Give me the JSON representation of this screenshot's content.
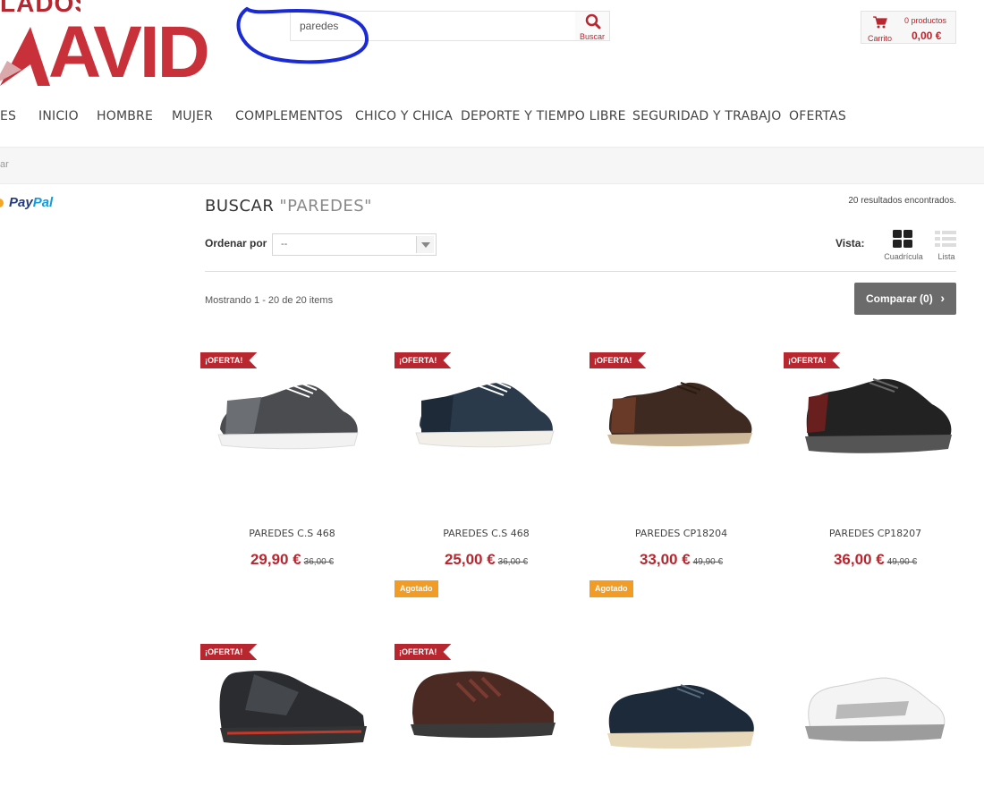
{
  "header": {
    "logo_top": "LADOS",
    "logo_main": "AVID",
    "search": {
      "value": "paredes",
      "button_label": "Buscar"
    },
    "cart": {
      "label": "Carrito",
      "count": "0 productos",
      "total": "0,00 €"
    }
  },
  "menu": [
    "ES",
    "INICIO",
    "HOMBRE",
    "MUJER",
    "COMPLEMENTOS",
    "CHICO Y CHICA",
    "DEPORTE Y TIEMPO LIBRE",
    "SEGURIDAD Y TRABAJO",
    "OFERTAS"
  ],
  "breadcrumb": "ar",
  "sidebar": {
    "paypal_a": "Pay",
    "paypal_b": "Pal"
  },
  "main": {
    "heading": "BUSCAR",
    "query": "\"PAREDES\"",
    "results": "20 resultados encontrados.",
    "sort_label": "Ordenar por",
    "sort_value": "--",
    "vista_label": "Vista:",
    "view_grid": "Cuadrícula",
    "view_list": "Lista",
    "showing": "Mostrando 1 - 20 de 20 items",
    "compare": "Comparar (0)"
  },
  "products": [
    {
      "badge": "¡OFERTA!",
      "name": "PAREDES C.S 468",
      "price": "29,90 €",
      "old": "36,00 €"
    },
    {
      "badge": "¡OFERTA!",
      "name": "PAREDES C.S 468",
      "price": "25,00 €",
      "old": "36,00 €"
    },
    {
      "badge": "¡OFERTA!",
      "name": "PAREDES CP18204",
      "price": "33,00 €",
      "old": "49,90 €"
    },
    {
      "badge": "¡OFERTA!",
      "name": "PAREDES CP18207",
      "price": "36,00 €",
      "old": "49,90 €"
    }
  ],
  "row2": [
    {
      "status": "",
      "badge": "¡OFERTA!"
    },
    {
      "status": "Agotado",
      "badge": "¡OFERTA!"
    },
    {
      "status": "Agotado",
      "badge": ""
    },
    {
      "status": "",
      "badge": ""
    }
  ],
  "colors": {
    "brand": "#b8262f",
    "agotado": "#f39c25",
    "annotation": "#1a2bd6"
  }
}
